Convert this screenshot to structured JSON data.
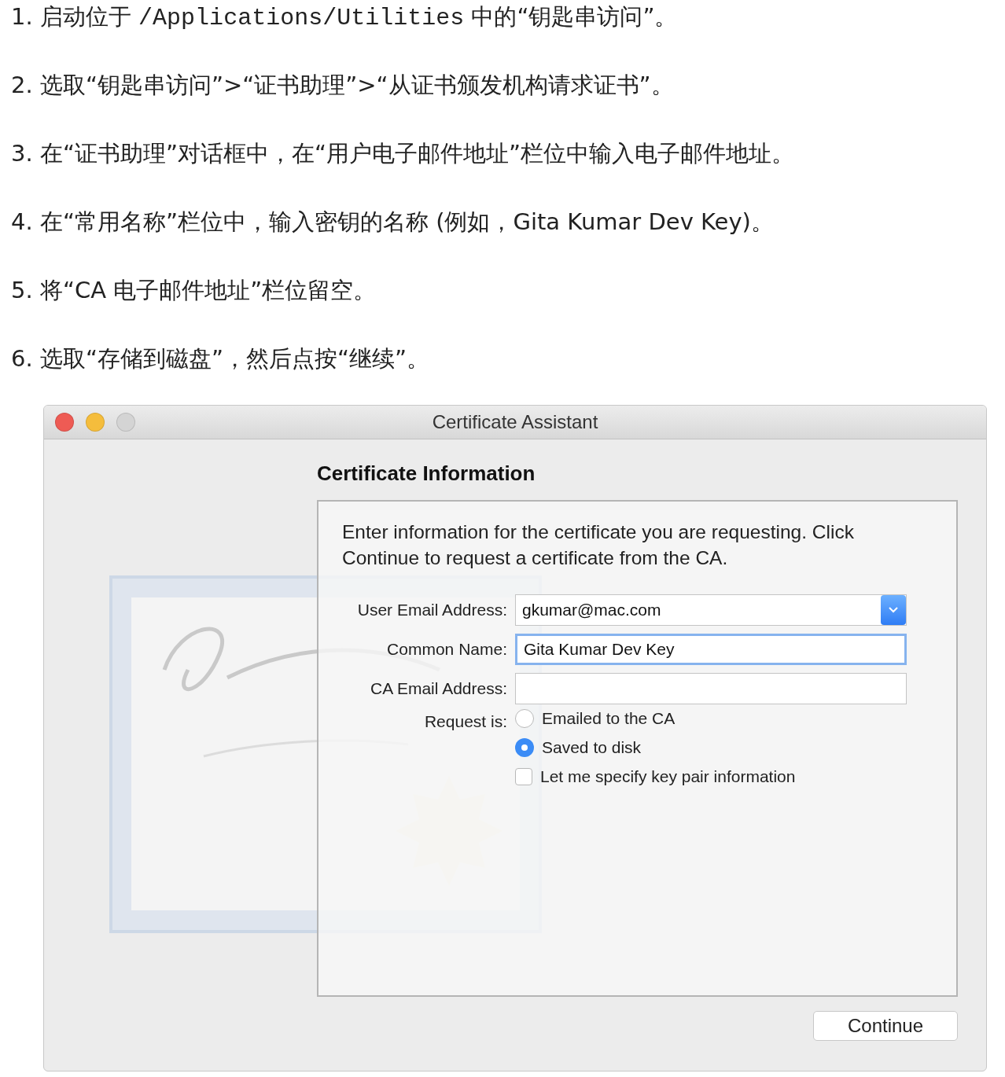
{
  "steps": [
    {
      "number": "1.",
      "parts": [
        {
          "kind": "text",
          "text": "启动位于 "
        },
        {
          "kind": "code",
          "text": "/Applications/Utilities"
        },
        {
          "kind": "text",
          "text": " 中的“钥匙串访问”。"
        }
      ]
    },
    {
      "number": "2.",
      "parts": [
        {
          "kind": "text",
          "text": "选取“钥匙串访问”>“证书助理”>“从证书颁发机构请求证书”。"
        }
      ]
    },
    {
      "number": "3.",
      "parts": [
        {
          "kind": "text",
          "text": "在“证书助理”对话框中，在“用户电子邮件地址”栏位中输入电子邮件地址。"
        }
      ]
    },
    {
      "number": "4.",
      "parts": [
        {
          "kind": "text",
          "text": "在“常用名称”栏位中，输入密钥的名称 (例如，Gita Kumar Dev Key)。"
        }
      ]
    },
    {
      "number": "5.",
      "parts": [
        {
          "kind": "text",
          "text": "将“CA 电子邮件地址”栏位留空。"
        }
      ]
    },
    {
      "number": "6.",
      "parts": [
        {
          "kind": "text",
          "text": "选取“存储到磁盘”，然后点按“继续”。"
        }
      ]
    }
  ],
  "window": {
    "title": "Certificate Assistant",
    "heading": "Certificate Information",
    "intro": "Enter information for the certificate you are requesting. Click Continue to request a certificate from the CA.",
    "fields": [
      {
        "label": "User Email Address:",
        "value": "gkumar@mac.com",
        "focused": false,
        "dropdown": true
      },
      {
        "label": "Common Name:",
        "value": "Gita Kumar Dev Key",
        "focused": true,
        "dropdown": false
      },
      {
        "label": "CA Email Address:",
        "focused": false,
        "dropdown": false
      }
    ],
    "request_label": "Request is:",
    "options": [
      {
        "kind": "radio",
        "label": "Emailed to the CA",
        "selected": false
      },
      {
        "kind": "radio",
        "label": "Saved to disk",
        "selected": true
      },
      {
        "kind": "checkbox",
        "label": "Let me specify key pair information",
        "checked": false
      }
    ],
    "button": "Continue"
  }
}
